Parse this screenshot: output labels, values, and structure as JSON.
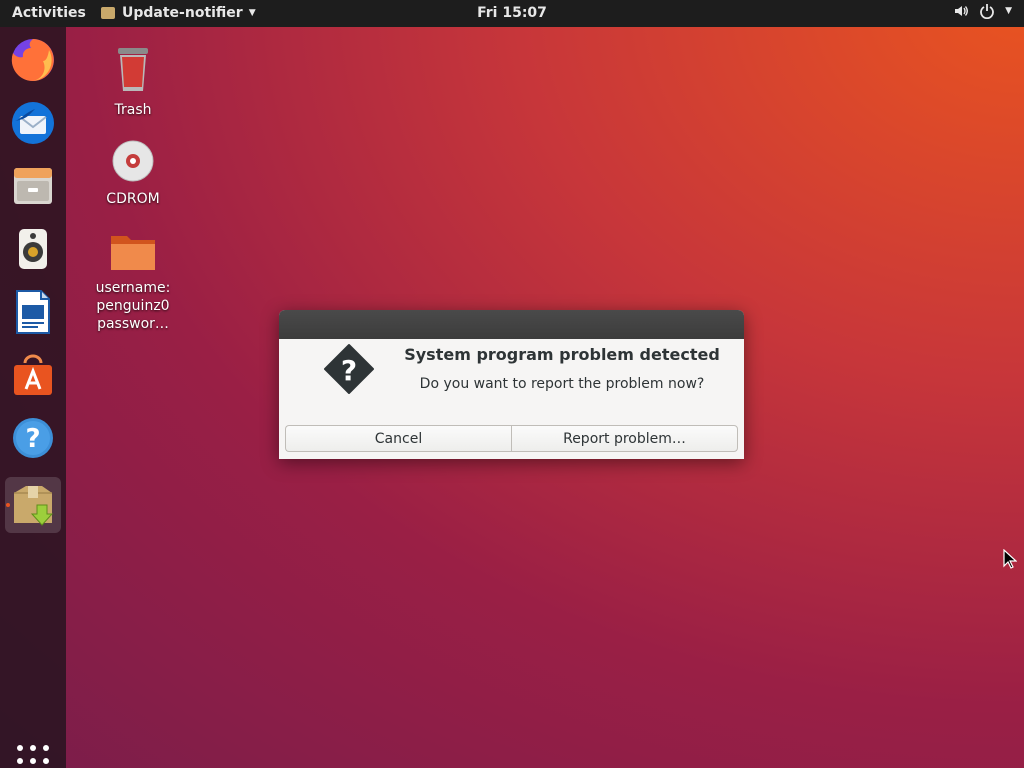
{
  "topbar": {
    "activities": "Activities",
    "app_name": "Update-notifier",
    "clock": "Fri 15:07",
    "icons": [
      "volume-icon",
      "power-icon",
      "chevron-down-icon"
    ]
  },
  "dock": {
    "items": [
      "firefox-icon",
      "thunderbird-icon",
      "files-icon",
      "rhythmbox-icon",
      "writer-icon",
      "software-icon",
      "help-icon",
      "update-notifier-icon"
    ],
    "show_apps": "show-applications-icon"
  },
  "desktop": {
    "trash_label": "Trash",
    "cdrom_label": "CDROM",
    "folder_line1": "username:",
    "folder_line2": "penguinz0",
    "folder_line3": "passwor…"
  },
  "dialog": {
    "heading": "System program problem detected",
    "message": "Do you want to report the problem now?",
    "cancel_label": "Cancel",
    "report_label": "Report problem…"
  },
  "colors": {
    "accent": "#e95420",
    "topbar": "#1d1d1d",
    "dialog_bg": "#f6f5f4"
  }
}
